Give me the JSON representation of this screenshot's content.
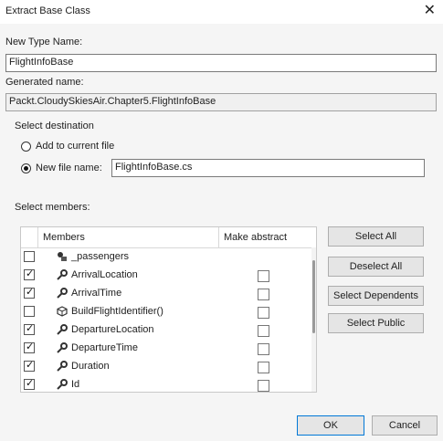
{
  "window": {
    "title": "Extract Base Class",
    "close_glyph": "✕"
  },
  "new_type_name": {
    "label": "New Type Name:",
    "value": "FlightInfoBase"
  },
  "generated_name": {
    "label": "Generated name:",
    "value": "Packt.CloudySkiesAir.Chapter5.FlightInfoBase"
  },
  "destination": {
    "label": "Select destination",
    "options": [
      {
        "label": "Add to current file",
        "checked": false
      },
      {
        "label": "New file name:",
        "checked": true
      }
    ],
    "file_name": "FlightInfoBase.cs"
  },
  "members_section": {
    "label": "Select members:",
    "columns": {
      "members": "Members",
      "make_abstract": "Make abstract"
    },
    "rows": [
      {
        "name": "_passengers",
        "icon": "field-icon",
        "selected": false,
        "abstract_box": false
      },
      {
        "name": "ArrivalLocation",
        "icon": "wrench-icon",
        "selected": true,
        "abstract_box": true
      },
      {
        "name": "ArrivalTime",
        "icon": "wrench-icon",
        "selected": true,
        "abstract_box": true
      },
      {
        "name": "BuildFlightIdentifier()",
        "icon": "method-cube-icon",
        "selected": false,
        "abstract_box": true
      },
      {
        "name": "DepartureLocation",
        "icon": "wrench-icon",
        "selected": true,
        "abstract_box": true
      },
      {
        "name": "DepartureTime",
        "icon": "wrench-icon",
        "selected": true,
        "abstract_box": true
      },
      {
        "name": "Duration",
        "icon": "wrench-icon",
        "selected": true,
        "abstract_box": true
      },
      {
        "name": "Id",
        "icon": "wrench-icon",
        "selected": true,
        "abstract_box": true
      }
    ]
  },
  "buttons": {
    "select_all": "Select All",
    "deselect_all": "Deselect All",
    "select_dependents": "Select Dependents",
    "select_public": "Select Public",
    "ok": "OK",
    "cancel": "Cancel"
  }
}
